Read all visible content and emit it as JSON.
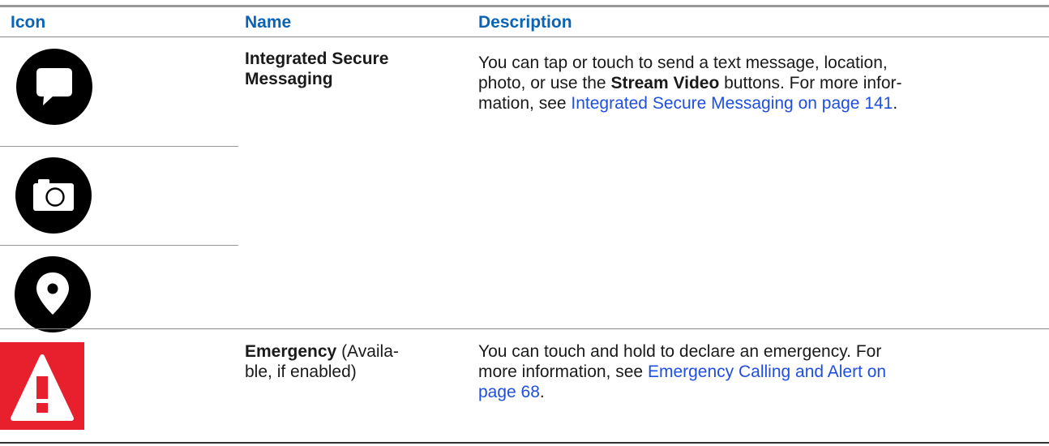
{
  "table": {
    "headers": {
      "icon": "Icon",
      "name": "Name",
      "description": "Description"
    },
    "rows": [
      {
        "icons": [
          "chat-bubble-icon",
          "camera-icon",
          "location-pin-icon"
        ],
        "name_line1": "Integrated Secure",
        "name_line2": "Messaging",
        "desc_line1": "You can tap or touch to send a text message, location,",
        "desc_line2_pre": "photo, or use the ",
        "desc_line2_bold": "Stream Video",
        "desc_line2_post": " buttons. For more infor-",
        "desc_line3_pre": "mation, see ",
        "desc_line3_link": "Integrated Secure Messaging on page 141",
        "desc_line3_post": "."
      },
      {
        "icons": [
          "emergency-warning-icon"
        ],
        "name_bold": "Emergency",
        "name_line1_rest": " (Availa-",
        "name_line2": "ble, if enabled)",
        "desc_line1": "You can touch and hold to declare an emergency. For",
        "desc_line2_pre": "more information, see ",
        "desc_line2_link": "Emergency Calling and Alert on",
        "desc_line3_link": "page 68",
        "desc_line3_post": "."
      }
    ]
  },
  "colors": {
    "header_text": "#0b63b6",
    "link_text": "#1f4fe0",
    "icon_black": "#000000",
    "emergency_red": "#e8202e"
  }
}
